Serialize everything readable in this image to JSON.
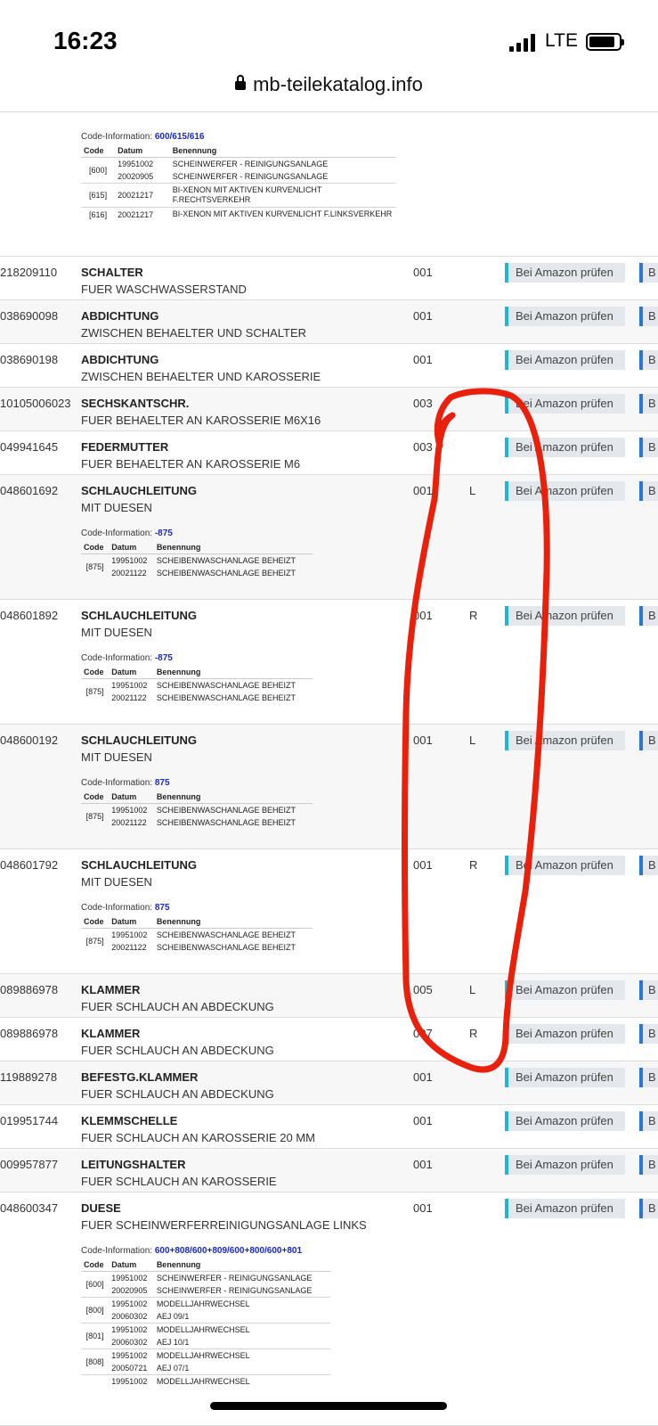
{
  "status": {
    "time": "16:23",
    "network": "LTE"
  },
  "browser": {
    "url": "mb-teilekatalog.info"
  },
  "labels": {
    "code_info": "Code-Information:",
    "col_code": "Code",
    "col_datum": "Datum",
    "col_benennung": "Benennung",
    "amazon": "Bei Amazon prüfen",
    "btn2": "B"
  },
  "top_code": {
    "value": "600/615/616",
    "entries": [
      {
        "code": "[600]",
        "lines": [
          {
            "datum": "19951002",
            "text": "SCHEINWERFER - REINIGUNGSANLAGE"
          },
          {
            "datum": "20020905",
            "text": "SCHEINWERFER - REINIGUNGSANLAGE"
          }
        ]
      },
      {
        "code": "[615]",
        "lines": [
          {
            "datum": "20021217",
            "text": "BI-XENON MIT AKTIVEN KURVENLICHT F.RECHTSVERKEHR"
          }
        ]
      },
      {
        "code": "[616]",
        "lines": [
          {
            "datum": "20021217",
            "text": "BI-XENON MIT AKTIVEN KURVENLICHT F.LINKSVERKEHR"
          }
        ]
      }
    ]
  },
  "parts": [
    {
      "partno": "218209110",
      "name": "SCHALTER",
      "desc": "FUER WASCHWASSERSTAND",
      "qty": "001",
      "side": ""
    },
    {
      "partno": "038690098",
      "name": "ABDICHTUNG",
      "desc": "ZWISCHEN BEHAELTER UND SCHALTER",
      "qty": "001",
      "side": ""
    },
    {
      "partno": "038690198",
      "name": "ABDICHTUNG",
      "desc": "ZWISCHEN BEHAELTER UND KAROSSERIE",
      "qty": "001",
      "side": ""
    },
    {
      "partno": "10105006023",
      "name": "SECHSKANTSCHR.",
      "desc": "FUER BEHAELTER AN KAROSSERIE M6X16",
      "qty": "003",
      "side": ""
    },
    {
      "partno": "049941645",
      "name": "FEDERMUTTER",
      "desc": "FUER BEHAELTER AN KAROSSERIE M6",
      "qty": "003",
      "side": ""
    },
    {
      "partno": "048601692",
      "name": "SCHLAUCHLEITUNG",
      "desc": "MIT DUESEN",
      "qty": "001",
      "side": "L",
      "code": {
        "value": "-875",
        "entries": [
          {
            "code": "[875]",
            "lines": [
              {
                "datum": "19951002",
                "text": "SCHEIBENWASCHANLAGE BEHEIZT"
              },
              {
                "datum": "20021122",
                "text": "SCHEIBENWASCHANLAGE BEHEIZT"
              }
            ]
          }
        ]
      }
    },
    {
      "partno": "048601892",
      "name": "SCHLAUCHLEITUNG",
      "desc": "MIT DUESEN",
      "qty": "001",
      "side": "R",
      "code": {
        "value": "-875",
        "entries": [
          {
            "code": "[875]",
            "lines": [
              {
                "datum": "19951002",
                "text": "SCHEIBENWASCHANLAGE BEHEIZT"
              },
              {
                "datum": "20021122",
                "text": "SCHEIBENWASCHANLAGE BEHEIZT"
              }
            ]
          }
        ]
      }
    },
    {
      "partno": "048600192",
      "name": "SCHLAUCHLEITUNG",
      "desc": "MIT DUESEN",
      "qty": "001",
      "side": "L",
      "code": {
        "value": "875",
        "entries": [
          {
            "code": "[875]",
            "lines": [
              {
                "datum": "19951002",
                "text": "SCHEIBENWASCHANLAGE BEHEIZT"
              },
              {
                "datum": "20021122",
                "text": "SCHEIBENWASCHANLAGE BEHEIZT"
              }
            ]
          }
        ]
      }
    },
    {
      "partno": "048601792",
      "name": "SCHLAUCHLEITUNG",
      "desc": "MIT DUESEN",
      "qty": "001",
      "side": "R",
      "code": {
        "value": "875",
        "entries": [
          {
            "code": "[875]",
            "lines": [
              {
                "datum": "19951002",
                "text": "SCHEIBENWASCHANLAGE BEHEIZT"
              },
              {
                "datum": "20021122",
                "text": "SCHEIBENWASCHANLAGE BEHEIZT"
              }
            ]
          }
        ]
      }
    },
    {
      "partno": "089886978",
      "name": "KLAMMER",
      "desc": "FUER SCHLAUCH AN ABDECKUNG",
      "qty": "005",
      "side": "L"
    },
    {
      "partno": "089886978",
      "name": "KLAMMER",
      "desc": "FUER SCHLAUCH AN ABDECKUNG",
      "qty": "007",
      "side": "R"
    },
    {
      "partno": "119889278",
      "name": "BEFESTG.KLAMMER",
      "desc": "FUER SCHLAUCH AN ABDECKUNG",
      "qty": "001",
      "side": ""
    },
    {
      "partno": "019951744",
      "name": "KLEMMSCHELLE",
      "desc": "FUER SCHLAUCH AN KAROSSERIE 20 MM",
      "qty": "001",
      "side": ""
    },
    {
      "partno": "009957877",
      "name": "LEITUNGSHALTER",
      "desc": "FUER SCHLAUCH AN KAROSSERIE",
      "qty": "001",
      "side": ""
    },
    {
      "partno": "048600347",
      "name": "DUESE",
      "desc": "FUER SCHEINWERFERREINIGUNGSANLAGE LINKS",
      "qty": "001",
      "side": "",
      "code": {
        "value": "600+808/600+809/600+800/600+801",
        "entries": [
          {
            "code": "[600]",
            "lines": [
              {
                "datum": "19951002",
                "text": "SCHEINWERFER - REINIGUNGSANLAGE"
              },
              {
                "datum": "20020905",
                "text": "SCHEINWERFER - REINIGUNGSANLAGE"
              }
            ]
          },
          {
            "code": "[800]",
            "lines": [
              {
                "datum": "19951002",
                "text": "MODELLJAHRWECHSEL"
              },
              {
                "datum": "20060302",
                "text": "AEJ 09/1"
              }
            ]
          },
          {
            "code": "[801]",
            "lines": [
              {
                "datum": "19951002",
                "text": "MODELLJAHRWECHSEL"
              },
              {
                "datum": "20060302",
                "text": "AEJ 10/1"
              }
            ]
          },
          {
            "code": "[808]",
            "lines": [
              {
                "datum": "19951002",
                "text": "MODELLJAHRWECHSEL"
              },
              {
                "datum": "20050721",
                "text": "AEJ 07/1"
              }
            ]
          },
          {
            "code": "",
            "lines": [
              {
                "datum": "19951002",
                "text": "MODELLJAHRWECHSEL"
              }
            ]
          }
        ]
      }
    }
  ],
  "annotation": {
    "color": "#e8200c"
  }
}
